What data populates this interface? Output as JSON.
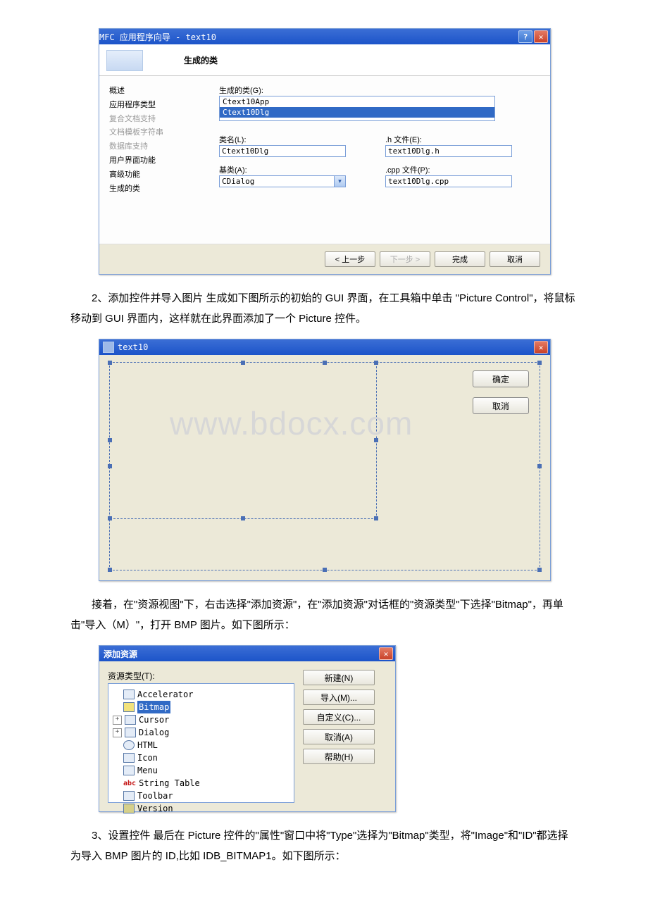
{
  "wiz": {
    "title": "MFC 应用程序向导 - text10",
    "banner": "生成的类",
    "nav": {
      "overview": "概述",
      "apptype": "应用程序类型",
      "compound": "复合文档支持",
      "doctpl": "文档模板字符串",
      "db": "数据库支持",
      "ui": "用户界面功能",
      "adv": "高级功能",
      "gen": "生成的类"
    },
    "lbl_gen": "生成的类(G):",
    "list": {
      "app": "Ctext10App",
      "dlg": "Ctext10Dlg"
    },
    "lbl_class": "类名(L):",
    "val_class": "Ctext10Dlg",
    "lbl_h": ".h 文件(E):",
    "val_h": "text10Dlg.h",
    "lbl_base": "基类(A):",
    "val_base": "CDialog",
    "lbl_cpp": ".cpp 文件(P):",
    "val_cpp": "text10Dlg.cpp",
    "btn_back": "< 上一步",
    "btn_next": "下一步 >",
    "btn_finish": "完成",
    "btn_cancel": "取消"
  },
  "para2": "2、添加控件并导入图片 生成如下图所示的初始的 GUI 界面，在工具箱中单击 \"Picture Control\"，将鼠标移动到 GUI 界面内，这样就在此界面添加了一个 Picture 控件。",
  "dlg2": {
    "title": "text10",
    "ok": "确定",
    "cancel": "取消",
    "wm": "www.bdocx.com"
  },
  "para3": "接着，在\"资源视图\"下，右击选择\"添加资源\"，在\"添加资源\"对话框的\"资源类型\"下选择\"Bitmap\"，再单击\"导入（M）\"，打开 BMP 图片。如下图所示：",
  "dlg3": {
    "title": "添加资源",
    "lbl_type": "资源类型(T):",
    "items": {
      "acc": "Accelerator",
      "bmp": "Bitmap",
      "cur": "Cursor",
      "dlg": "Dialog",
      "html": "HTML",
      "icon": "Icon",
      "menu": "Menu",
      "str": "String Table",
      "tb": "Toolbar",
      "ver": "Version"
    },
    "btn_new": "新建(N)",
    "btn_imp": "导入(M)...",
    "btn_cust": "自定义(C)...",
    "btn_cancel": "取消(A)",
    "btn_help": "帮助(H)"
  },
  "para4": "3、设置控件 最后在 Picture 控件的\"属性\"窗口中将\"Type\"选择为\"Bitmap\"类型，将\"Image\"和\"ID\"都选择为导入 BMP 图片的 ID,比如 IDB_BITMAP1。如下图所示："
}
